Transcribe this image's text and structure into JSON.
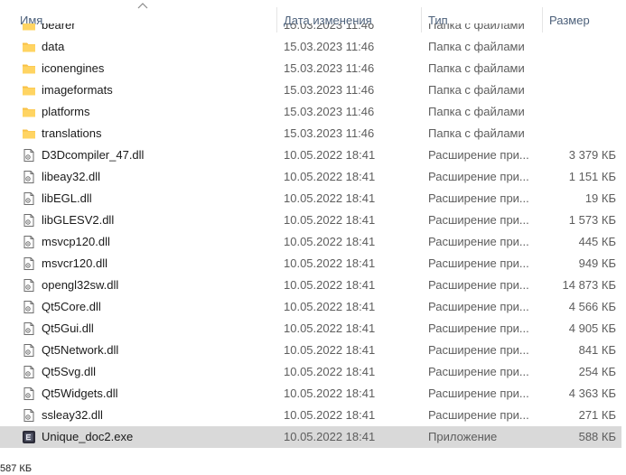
{
  "columns": {
    "name": "Имя",
    "date": "Дата изменения",
    "type": "Тип",
    "size": "Размер"
  },
  "rows": [
    {
      "name": "bearer",
      "date": "15.03.2023 11:46",
      "type": "Папка с файлами",
      "size": "",
      "icon": "folder-icon"
    },
    {
      "name": "data",
      "date": "15.03.2023 11:46",
      "type": "Папка с файлами",
      "size": "",
      "icon": "folder-icon"
    },
    {
      "name": "iconengines",
      "date": "15.03.2023 11:46",
      "type": "Папка с файлами",
      "size": "",
      "icon": "folder-icon"
    },
    {
      "name": "imageformats",
      "date": "15.03.2023 11:46",
      "type": "Папка с файлами",
      "size": "",
      "icon": "folder-icon"
    },
    {
      "name": "platforms",
      "date": "15.03.2023 11:46",
      "type": "Папка с файлами",
      "size": "",
      "icon": "folder-icon"
    },
    {
      "name": "translations",
      "date": "15.03.2023 11:46",
      "type": "Папка с файлами",
      "size": "",
      "icon": "folder-icon"
    },
    {
      "name": "D3Dcompiler_47.dll",
      "date": "10.05.2022 18:41",
      "type": "Расширение при...",
      "size": "3 379 КБ",
      "icon": "dll-file-icon"
    },
    {
      "name": "libeay32.dll",
      "date": "10.05.2022 18:41",
      "type": "Расширение при...",
      "size": "1 151 КБ",
      "icon": "dll-file-icon"
    },
    {
      "name": "libEGL.dll",
      "date": "10.05.2022 18:41",
      "type": "Расширение при...",
      "size": "19 КБ",
      "icon": "dll-file-icon"
    },
    {
      "name": "libGLESV2.dll",
      "date": "10.05.2022 18:41",
      "type": "Расширение при...",
      "size": "1 573 КБ",
      "icon": "dll-file-icon"
    },
    {
      "name": "msvcp120.dll",
      "date": "10.05.2022 18:41",
      "type": "Расширение при...",
      "size": "445 КБ",
      "icon": "dll-file-icon"
    },
    {
      "name": "msvcr120.dll",
      "date": "10.05.2022 18:41",
      "type": "Расширение при...",
      "size": "949 КБ",
      "icon": "dll-file-icon"
    },
    {
      "name": "opengl32sw.dll",
      "date": "10.05.2022 18:41",
      "type": "Расширение при...",
      "size": "14 873 КБ",
      "icon": "dll-file-icon"
    },
    {
      "name": "Qt5Core.dll",
      "date": "10.05.2022 18:41",
      "type": "Расширение при...",
      "size": "4 566 КБ",
      "icon": "dll-file-icon"
    },
    {
      "name": "Qt5Gui.dll",
      "date": "10.05.2022 18:41",
      "type": "Расширение при...",
      "size": "4 905 КБ",
      "icon": "dll-file-icon"
    },
    {
      "name": "Qt5Network.dll",
      "date": "10.05.2022 18:41",
      "type": "Расширение при...",
      "size": "841 КБ",
      "icon": "dll-file-icon"
    },
    {
      "name": "Qt5Svg.dll",
      "date": "10.05.2022 18:41",
      "type": "Расширение при...",
      "size": "254 КБ",
      "icon": "dll-file-icon"
    },
    {
      "name": "Qt5Widgets.dll",
      "date": "10.05.2022 18:41",
      "type": "Расширение при...",
      "size": "4 363 КБ",
      "icon": "dll-file-icon"
    },
    {
      "name": "ssleay32.dll",
      "date": "10.05.2022 18:41",
      "type": "Расширение при...",
      "size": "271 КБ",
      "icon": "dll-file-icon"
    },
    {
      "name": "Unique_doc2.exe",
      "date": "10.05.2022 18:41",
      "type": "Приложение",
      "size": "588 КБ",
      "icon": "exe-app-icon",
      "selected": true
    }
  ],
  "status": {
    "text": "587 КБ"
  },
  "colors": {
    "folder": "#f8c146",
    "header_text": "#4c607a",
    "selection": "#d9d9d9"
  }
}
